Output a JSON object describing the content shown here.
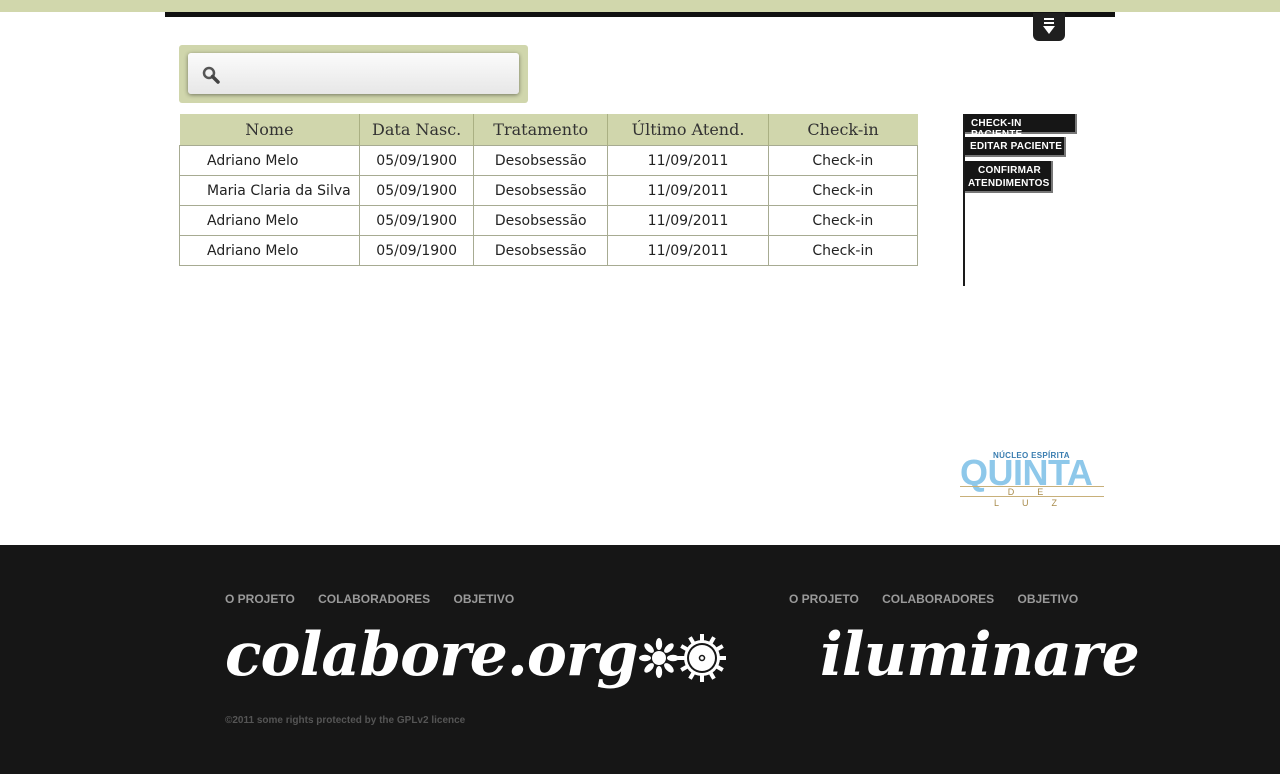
{
  "search": {
    "placeholder": ""
  },
  "table": {
    "headers": [
      "Nome",
      "Data Nasc.",
      "Tratamento",
      "Último Atend.",
      "Check-in"
    ],
    "rows": [
      [
        "Adriano Melo",
        "05/09/1900",
        "Desobsessão",
        "11/09/2011",
        "Check-in"
      ],
      [
        "Maria Claria da Silva",
        "05/09/1900",
        "Desobsessão",
        "11/09/2011",
        "Check-in"
      ],
      [
        "Adriano Melo",
        "05/09/1900",
        "Desobsessão",
        "11/09/2011",
        "Check-in"
      ],
      [
        "Adriano Melo",
        "05/09/1900",
        "Desobsessão",
        "11/09/2011",
        "Check-in"
      ]
    ]
  },
  "actions": {
    "checkin": "CHECK-IN PACIENTE",
    "edit": "EDITAR PACIENTE",
    "confirm_1": "CONFIRMAR",
    "confirm_2": "ATENDIMENTOS"
  },
  "logo": {
    "top": "NÚCLEO ESPÍRITA",
    "main": "QUINTA",
    "bottom": "DE LUZ"
  },
  "footer": {
    "nav_left": [
      "O PROJETO",
      "COLABORADORES",
      "OBJETIVO"
    ],
    "nav_right": [
      "O PROJETO",
      "COLABORADORES",
      "OBJETIVO"
    ],
    "brand_left": "colabore.org",
    "brand_right": "iluminare",
    "copyright": "©2011 some rights protected by the GPLv2 licence"
  },
  "icons": [
    "menu-toggle-icon",
    "search-icon",
    "sun-icons"
  ],
  "colors": {
    "accent": "#d0d6ac",
    "dark": "#161616"
  }
}
